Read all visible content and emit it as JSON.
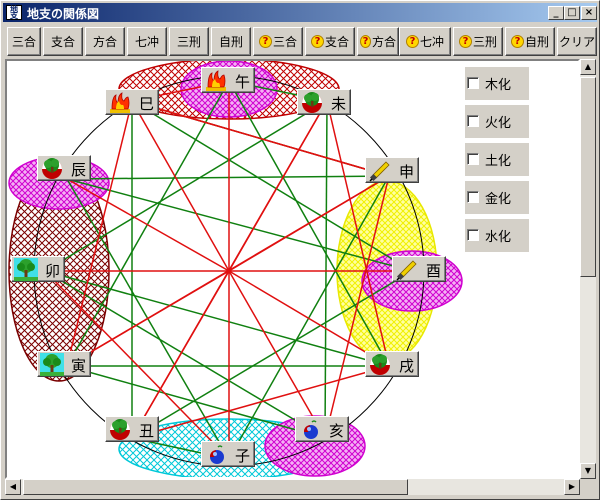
{
  "window": {
    "title": "地支の関係図",
    "icon_text": "地支",
    "controls": [
      "_",
      "□",
      "×"
    ]
  },
  "toolbar": {
    "buttons": [
      {
        "label": "三合",
        "question": false
      },
      {
        "label": "支合",
        "question": false
      },
      {
        "label": "方合",
        "question": false
      },
      {
        "label": "七冲",
        "question": false
      },
      {
        "label": "三刑",
        "question": false
      },
      {
        "label": "自刑",
        "question": false
      },
      {
        "label": "三合",
        "question": true
      },
      {
        "label": "支合",
        "question": true
      },
      {
        "label": "方合",
        "question": true
      },
      {
        "label": "七冲",
        "question": true
      },
      {
        "label": "三刑",
        "question": true
      },
      {
        "label": "自刑",
        "question": true
      },
      {
        "label": "クリア",
        "question": false
      }
    ]
  },
  "branches": [
    {
      "label": "午",
      "element": "fire"
    },
    {
      "label": "未",
      "element": "earth"
    },
    {
      "label": "申",
      "element": "metal"
    },
    {
      "label": "酉",
      "element": "metal"
    },
    {
      "label": "戌",
      "element": "earth"
    },
    {
      "label": "亥",
      "element": "water"
    },
    {
      "label": "子",
      "element": "water"
    },
    {
      "label": "丑",
      "element": "earth"
    },
    {
      "label": "寅",
      "element": "wood"
    },
    {
      "label": "卯",
      "element": "wood"
    },
    {
      "label": "辰",
      "element": "earth"
    },
    {
      "label": "巳",
      "element": "fire"
    }
  ],
  "transforms": [
    {
      "label": "木化",
      "checked": false
    },
    {
      "label": "火化",
      "checked": false
    },
    {
      "label": "土化",
      "checked": false
    },
    {
      "label": "金化",
      "checked": false
    },
    {
      "label": "水化",
      "checked": false
    }
  ],
  "colors": {
    "red_line": "#e01010",
    "green_line": "#108010",
    "magenta": "#d000d0",
    "fire_zone": "#c00000",
    "metal_zone": "#e8e800",
    "water_zone": "#00c8d8",
    "wood_zone": "#7a0000"
  },
  "scrollbars": {
    "up": "▲",
    "down": "▼",
    "left": "◀",
    "right": "▶"
  }
}
